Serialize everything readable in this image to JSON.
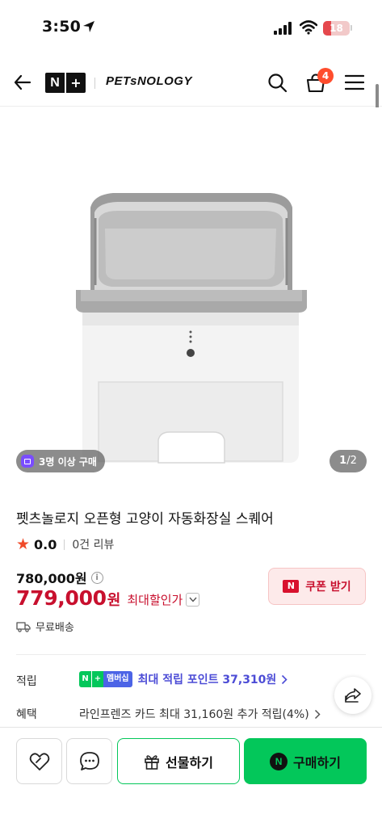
{
  "status_bar": {
    "time": "3:50",
    "battery": "18"
  },
  "header": {
    "logo_n": "N",
    "logo_plus": "+",
    "brand": "PETsNOLOGY",
    "cart_count": "4"
  },
  "gallery": {
    "buyer_badge": "3명 이상 구매",
    "page_current": "1",
    "page_total": "/2"
  },
  "product": {
    "title": "펫츠놀로지 오픈형 고양이 자동화장실 스퀘어",
    "rating": "0.0",
    "review_count": "0건 리뷰",
    "original_price": "780,000원",
    "sale_price": "779,000",
    "sale_unit": "원",
    "discount_label": "최대할인가",
    "coupon_label": "쿠폰 받기",
    "shipping": "무료배송"
  },
  "benefits": {
    "points_label": "적립",
    "membership_n": "N",
    "membership_plus": "+",
    "membership_text": "멤버십",
    "points_text": "최대 적립 포인트 37,310원",
    "benefit_label": "혜택",
    "benefit_text": "라인프렌즈 카드 최대 31,160원 추가 적립(4%)"
  },
  "bottom_bar": {
    "gift_label": "선물하기",
    "buy_label": "구매하기",
    "buy_icon": "N"
  },
  "colors": {
    "accent_green": "#03c75a",
    "sale_red": "#c8102e",
    "points_purple": "#4c4cd6"
  }
}
